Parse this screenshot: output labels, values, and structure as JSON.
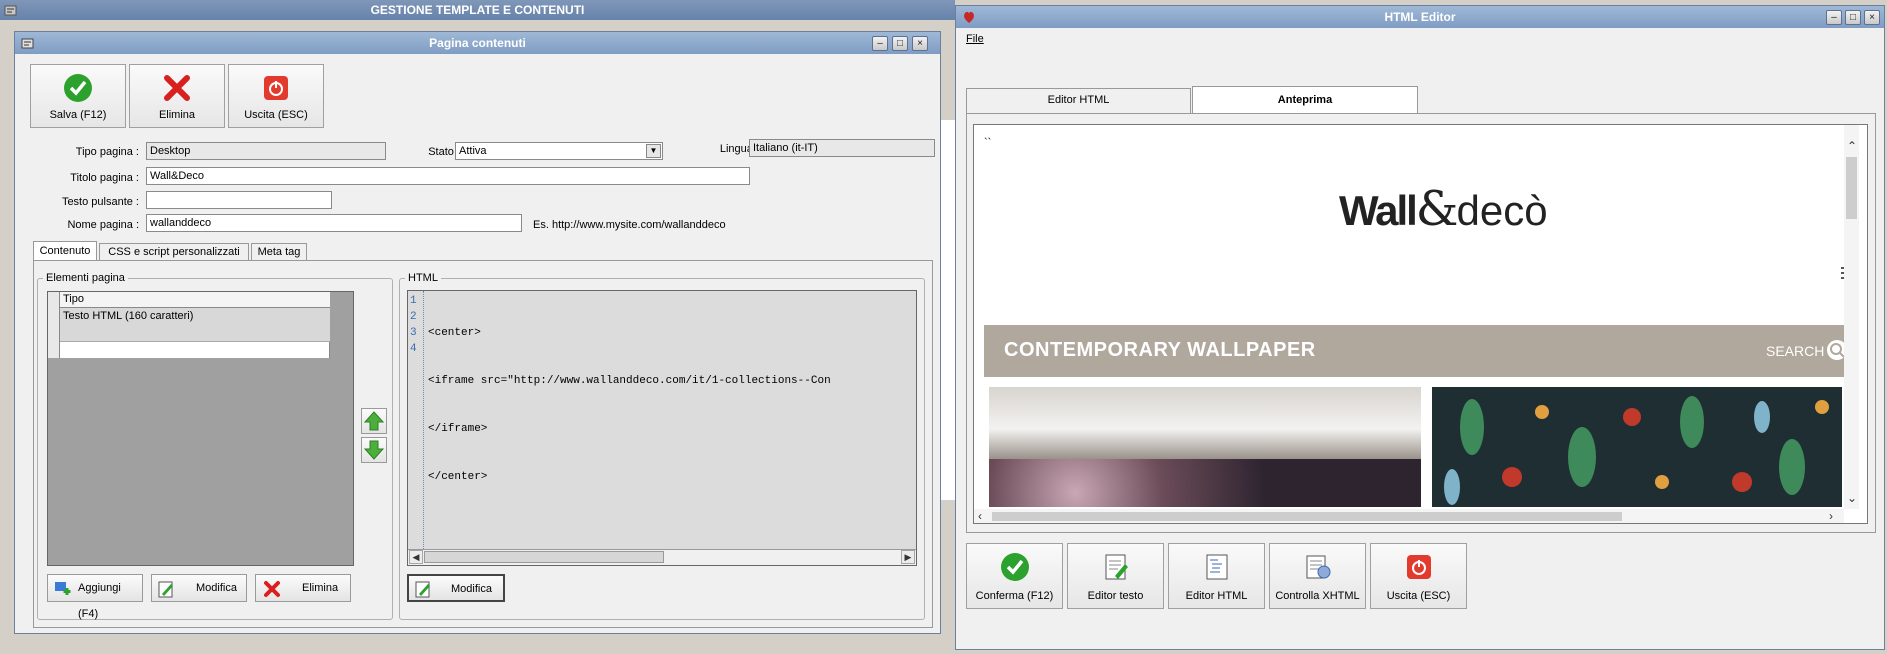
{
  "bg_window": {
    "title": "GESTIONE TEMPLATE E CONTENUTI"
  },
  "pagina": {
    "title": "Pagina contenuti",
    "toolbar": {
      "save": "Salva (F12)",
      "delete": "Elimina",
      "exit": "Uscita (ESC)"
    },
    "fields": {
      "tipo_label": "Tipo pagina :",
      "tipo_value": "Desktop",
      "stato_label": "Stato :",
      "stato_value": "Attiva",
      "lingua_label": "Lingua :",
      "lingua_value": "Italiano (it-IT)",
      "titolo_label": "Titolo pagina :",
      "titolo_value": "Wall&Deco",
      "pulsante_label": "Testo pulsante :",
      "pulsante_value": "",
      "nome_label": "Nome pagina :",
      "nome_value": "wallanddeco",
      "nome_hint": "Es. http://www.mysite.com/wallanddeco"
    },
    "tabs": [
      "Contenuto",
      "CSS e script personalizzati",
      "Meta tag"
    ],
    "elementi": {
      "legend": "Elementi pagina",
      "column": "Tipo",
      "rows": [
        "Testo HTML (160 caratteri)"
      ],
      "buttons": {
        "add": "Aggiungi (F4)",
        "edit": "Modifica",
        "delete": "Elimina"
      }
    },
    "html": {
      "legend": "HTML",
      "lines": [
        {
          "n": "1",
          "text": "<center>"
        },
        {
          "n": "2",
          "text": "<iframe src=\"http://www.wallanddeco.com/it/1-collections--Con"
        },
        {
          "n": "3",
          "text": "</iframe>"
        },
        {
          "n": "4",
          "text": "</center>"
        }
      ],
      "edit_button": "Modifica"
    }
  },
  "editor": {
    "title": "HTML Editor",
    "menu_file": "File",
    "tabs": {
      "editor": "Editor HTML",
      "preview": "Anteprima"
    },
    "preview": {
      "backticks": "``",
      "logo_left": "Wall",
      "logo_amp": "&",
      "logo_right": "decò",
      "banner": "CONTEMPORARY WALLPAPER",
      "search": "SEARCH"
    },
    "buttons": {
      "confirm": "Conferma (F12)",
      "text_editor": "Editor testo",
      "html_editor": "Editor HTML",
      "xhtml": "Controlla XHTML",
      "exit": "Uscita (ESC)"
    }
  },
  "colors": {
    "accent_green": "#2da12d",
    "danger_red": "#d8201e",
    "titlebar": "#7f9cc3"
  }
}
